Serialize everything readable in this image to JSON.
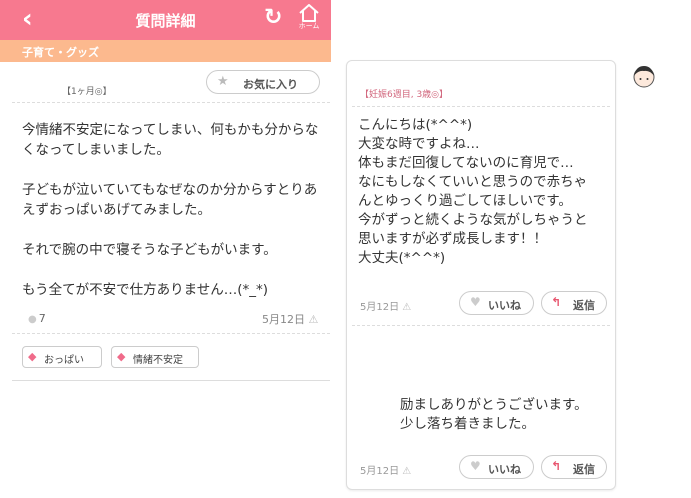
{
  "header": {
    "back_icon": "‹",
    "title": "質問詳細",
    "reload_icon": "↻",
    "home_label": "ホーム"
  },
  "category": "子育て・グッズ",
  "question": {
    "age": "【1ヶ月◎】",
    "favorite_label": "お気に入り",
    "paragraphs": [
      "今情緒不安定になってしまい、何もかも分からなくなってしまいました。",
      "子どもが泣いていてもなぜなのか分からすとりあえずおっぱいあげてみました。",
      "それで腕の中で寝そうな子どもがいます。",
      "もう全てが不安で仕方ありません…(*_*)"
    ],
    "comment_count": "7",
    "date": "5月12日",
    "tags": [
      "おっぱい",
      "情緒不安定"
    ]
  },
  "answer": {
    "age": "【妊娠6週目, 3歳◎】",
    "lines": [
      "こんにちは(*^^*)",
      "大変な時ですよね…",
      "体もまだ回復してないのに育児で…",
      "なにもしなくていいと思うので赤ちゃ",
      "んとゆっくり過ごしてほしいです。",
      "今がずっと続くような気がしちゃうと",
      "思いますが必ず成長します！！",
      "大丈夫(*^^*)"
    ],
    "date": "5月12日",
    "like_label": "いいね",
    "reply_label": "返信"
  },
  "followup": {
    "lines": [
      "励ましありがとうございます。",
      "少し落ち着きました。"
    ],
    "date": "5月12日",
    "like_label": "いいね",
    "reply_label": "返信"
  },
  "colors": {
    "header": "#f7798f",
    "category_bar": "#fcb98e",
    "tag_icon": "#f06b8a",
    "reply_icon": "#e8566f"
  }
}
